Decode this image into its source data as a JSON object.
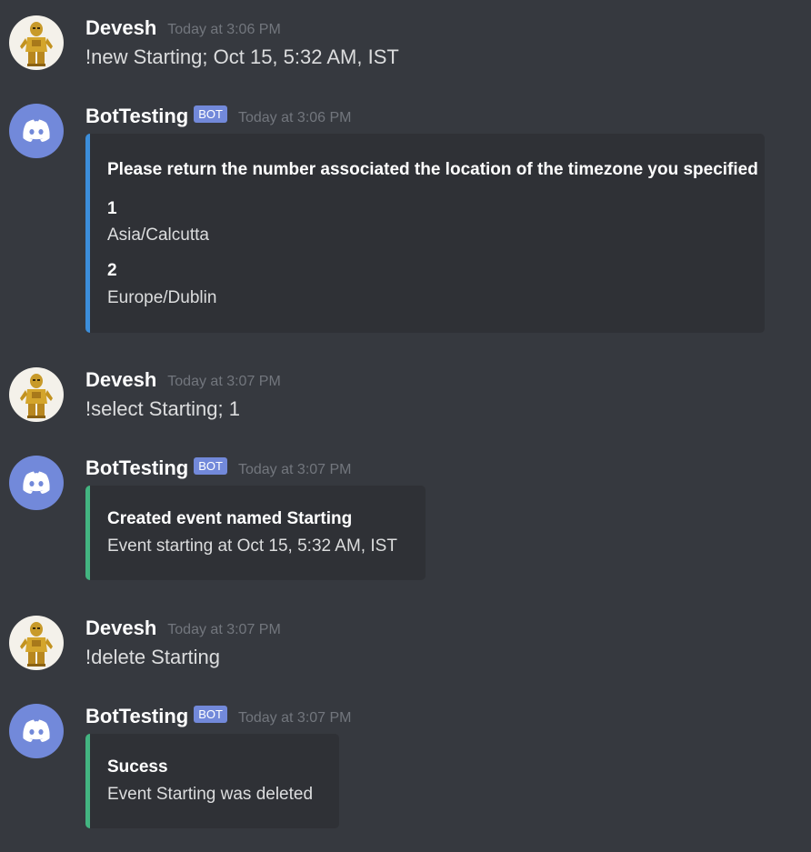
{
  "colors": {
    "background": "#36393f",
    "embed_background": "#2f3136",
    "bot_tag": "#7289da",
    "embed_blue": "#3c8edb",
    "embed_green": "#43b581",
    "timestamp": "#72767d"
  },
  "messages": [
    {
      "author": "Devesh",
      "avatar_icon": "lego-c3po-avatar-icon",
      "timestamp": "Today at 3:06 PM",
      "text": "!new Starting; Oct 15, 5:32 AM, IST"
    },
    {
      "author": "BotTesting",
      "bot_tag": "BOT",
      "avatar_icon": "discord-logo-avatar-icon",
      "timestamp": "Today at 3:06 PM",
      "embed": {
        "title": "Please return the number associated the location of the timezone you specified",
        "fields": [
          {
            "name": "1",
            "value": "Asia/Calcutta"
          },
          {
            "name": "2",
            "value": "Europe/Dublin"
          }
        ]
      }
    },
    {
      "author": "Devesh",
      "avatar_icon": "lego-c3po-avatar-icon",
      "timestamp": "Today at 3:07 PM",
      "text": "!select Starting; 1"
    },
    {
      "author": "BotTesting",
      "bot_tag": "BOT",
      "avatar_icon": "discord-logo-avatar-icon",
      "timestamp": "Today at 3:07 PM",
      "embed": {
        "title": "Created event named Starting",
        "description": "Event starting at Oct 15, 5:32 AM, IST"
      }
    },
    {
      "author": "Devesh",
      "avatar_icon": "lego-c3po-avatar-icon",
      "timestamp": "Today at 3:07 PM",
      "text": "!delete Starting"
    },
    {
      "author": "BotTesting",
      "bot_tag": "BOT",
      "avatar_icon": "discord-logo-avatar-icon",
      "timestamp": "Today at 3:07 PM",
      "embed": {
        "title": "Sucess",
        "description": "Event Starting was deleted"
      }
    }
  ]
}
